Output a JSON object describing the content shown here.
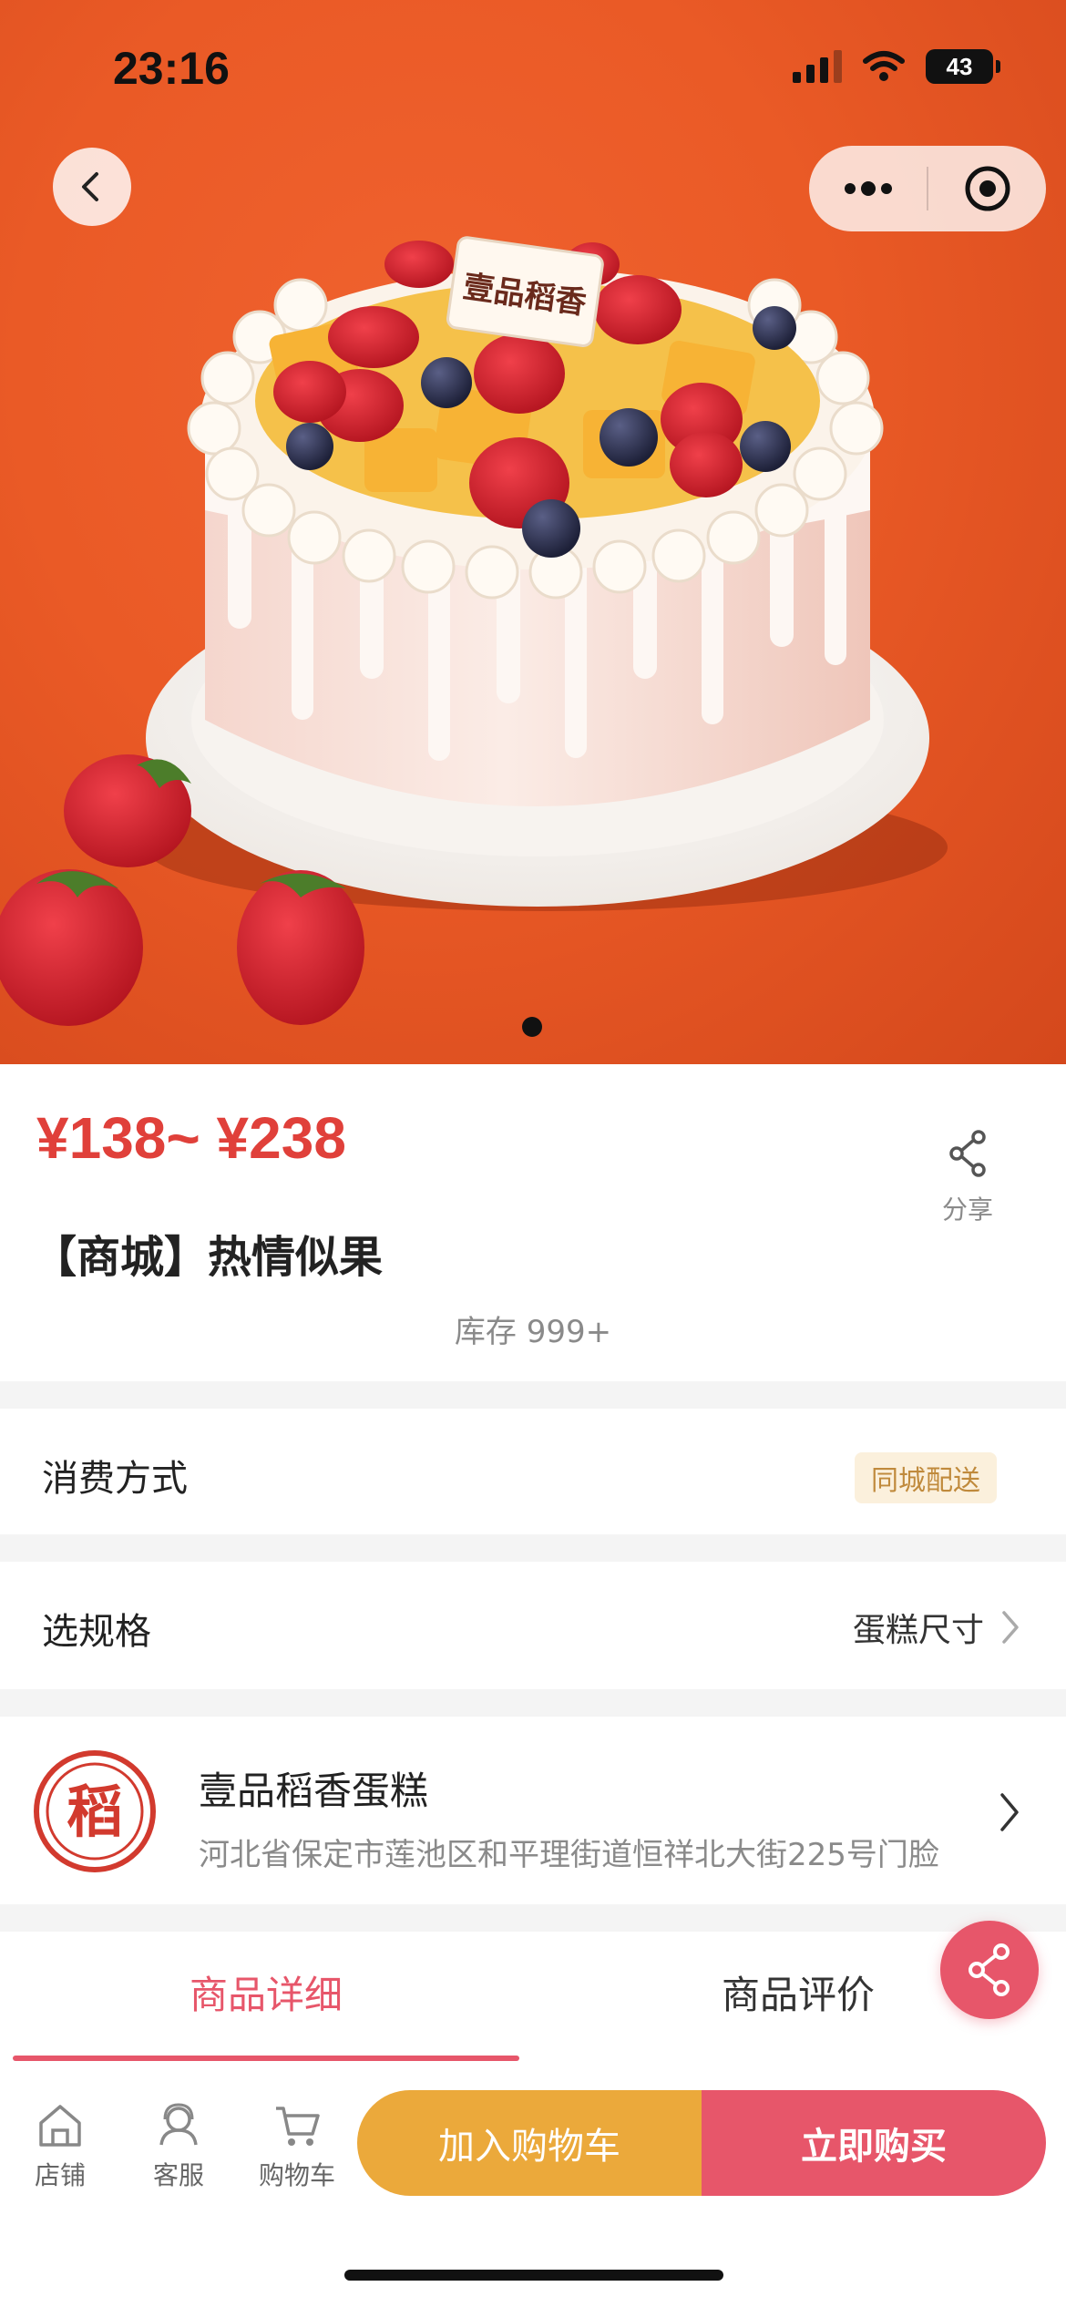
{
  "status": {
    "time": "23:16",
    "battery": "43"
  },
  "product": {
    "price_range": "¥138~ ¥238",
    "title": "【商城】热情似果",
    "stock": "库存 999+",
    "share_label": "分享"
  },
  "consumption": {
    "label": "消费方式",
    "value": "同城配送"
  },
  "spec": {
    "label": "选规格",
    "value": "蛋糕尺寸"
  },
  "shop": {
    "logo_char": "稻",
    "name": "壹品稻香蛋糕",
    "address": "河北省保定市莲池区和平理街道恒祥北大街225号门脸"
  },
  "tabs": [
    {
      "label": "商品详细",
      "active": true
    },
    {
      "label": "商品评价",
      "active": false
    }
  ],
  "bottom_nav": [
    {
      "label": "店铺",
      "icon": "shop-icon"
    },
    {
      "label": "客服",
      "icon": "customer-service-icon"
    },
    {
      "label": "购物车",
      "icon": "cart-icon"
    }
  ],
  "actions": {
    "add_to_cart": "加入购物车",
    "buy_now": "立即购买"
  },
  "hero": {
    "cake_topper_text": "壹品稻香",
    "slide_count": 1,
    "active_slide": 1
  },
  "colors": {
    "accent": "#e7566a",
    "price": "#e0403a",
    "cart_btn": "#eba93b",
    "hero_bg": "#ea5a26"
  }
}
